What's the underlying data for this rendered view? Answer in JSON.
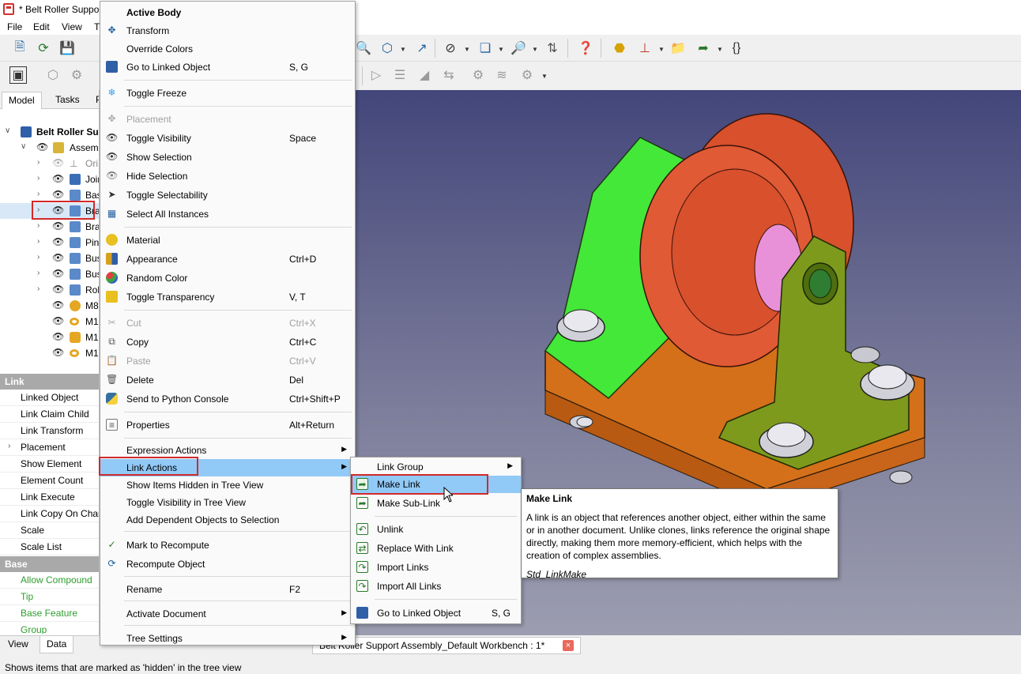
{
  "window": {
    "title": "* Belt Roller Suppor"
  },
  "menubar": {
    "file": "File",
    "edit": "Edit",
    "view": "View",
    "tools_partial": "T"
  },
  "panel_tabs": {
    "model": "Model",
    "tasks": "Tasks",
    "third_partial": "P"
  },
  "tree": {
    "root": "Belt Roller Sup",
    "items": [
      {
        "label": "Assembl"
      },
      {
        "label": "Ori"
      },
      {
        "label": "Join"
      },
      {
        "label": "Bas"
      },
      {
        "label": "Bra"
      },
      {
        "label": "Bra"
      },
      {
        "label": "Pin"
      },
      {
        "label": "Bus"
      },
      {
        "label": "Bus"
      },
      {
        "label": "Rol"
      },
      {
        "label": "M8"
      },
      {
        "label": "M1"
      },
      {
        "label": "M1"
      },
      {
        "label": "M1"
      }
    ]
  },
  "properties": {
    "group_link": "Link",
    "link_rows": [
      "Linked Object",
      "Link Claim Child",
      "Link Transform",
      "Placement",
      "Show Element",
      "Element Count",
      "Link Execute",
      "Link Copy On Char",
      "Scale",
      "Scale List"
    ],
    "group_base": "Base",
    "base_rows": [
      "Allow Compound",
      "Tip",
      "Base Feature",
      "Group"
    ]
  },
  "bottom_tabs": {
    "view": "View",
    "data": "Data"
  },
  "document_tab": {
    "label": "Belt Roller Support Assembly_Default Workbench : 1*",
    "close": "×"
  },
  "statusbar": {
    "text": "Shows items that are marked as 'hidden' in the tree view"
  },
  "context_menu": {
    "items": [
      {
        "label": "Active Body",
        "shortcut": ""
      },
      {
        "label": "Transform",
        "shortcut": ""
      },
      {
        "label": "Override Colors",
        "shortcut": ""
      },
      {
        "label": "Go to Linked Object",
        "shortcut": "S, G"
      },
      {
        "label": "Toggle Freeze",
        "shortcut": ""
      },
      {
        "label": "Placement",
        "shortcut": ""
      },
      {
        "label": "Toggle Visibility",
        "shortcut": "Space"
      },
      {
        "label": "Show Selection",
        "shortcut": ""
      },
      {
        "label": "Hide Selection",
        "shortcut": ""
      },
      {
        "label": "Toggle Selectability",
        "shortcut": ""
      },
      {
        "label": "Select All Instances",
        "shortcut": ""
      },
      {
        "label": "Material",
        "shortcut": ""
      },
      {
        "label": "Appearance",
        "shortcut": "Ctrl+D"
      },
      {
        "label": "Random Color",
        "shortcut": ""
      },
      {
        "label": "Toggle Transparency",
        "shortcut": "V, T"
      },
      {
        "label": "Cut",
        "shortcut": "Ctrl+X"
      },
      {
        "label": "Copy",
        "shortcut": "Ctrl+C"
      },
      {
        "label": "Paste",
        "shortcut": "Ctrl+V"
      },
      {
        "label": "Delete",
        "shortcut": "Del"
      },
      {
        "label": "Send to Python Console",
        "shortcut": "Ctrl+Shift+P"
      },
      {
        "label": "Properties",
        "shortcut": "Alt+Return"
      },
      {
        "label": "Expression Actions",
        "shortcut": ""
      },
      {
        "label": "Link Actions",
        "shortcut": ""
      },
      {
        "label": "Show Items Hidden in Tree View",
        "shortcut": ""
      },
      {
        "label": "Toggle Visibility in Tree View",
        "shortcut": ""
      },
      {
        "label": "Add Dependent Objects to Selection",
        "shortcut": ""
      },
      {
        "label": "Mark to Recompute",
        "shortcut": ""
      },
      {
        "label": "Recompute Object",
        "shortcut": ""
      },
      {
        "label": "Rename",
        "shortcut": "F2"
      },
      {
        "label": "Activate Document",
        "shortcut": ""
      },
      {
        "label": "Tree Settings",
        "shortcut": ""
      }
    ]
  },
  "sub_menu": {
    "items": [
      {
        "label": "Link Group",
        "shortcut": ""
      },
      {
        "label": "Make Link",
        "shortcut": ""
      },
      {
        "label": "Make Sub-Link",
        "shortcut": ""
      },
      {
        "label": "Unlink",
        "shortcut": ""
      },
      {
        "label": "Replace With Link",
        "shortcut": ""
      },
      {
        "label": "Import Links",
        "shortcut": ""
      },
      {
        "label": "Import All Links",
        "shortcut": ""
      },
      {
        "label": "Go to Linked Object",
        "shortcut": "S, G"
      }
    ]
  },
  "tooltip": {
    "title": "Make Link",
    "body": "A link is an object that references another object, either within the same or in another document. Unlike clones, links reference the original shape directly, making them more memory-efficient, which helps with the creation of complex assemblies.",
    "command": "Std_LinkMake"
  }
}
